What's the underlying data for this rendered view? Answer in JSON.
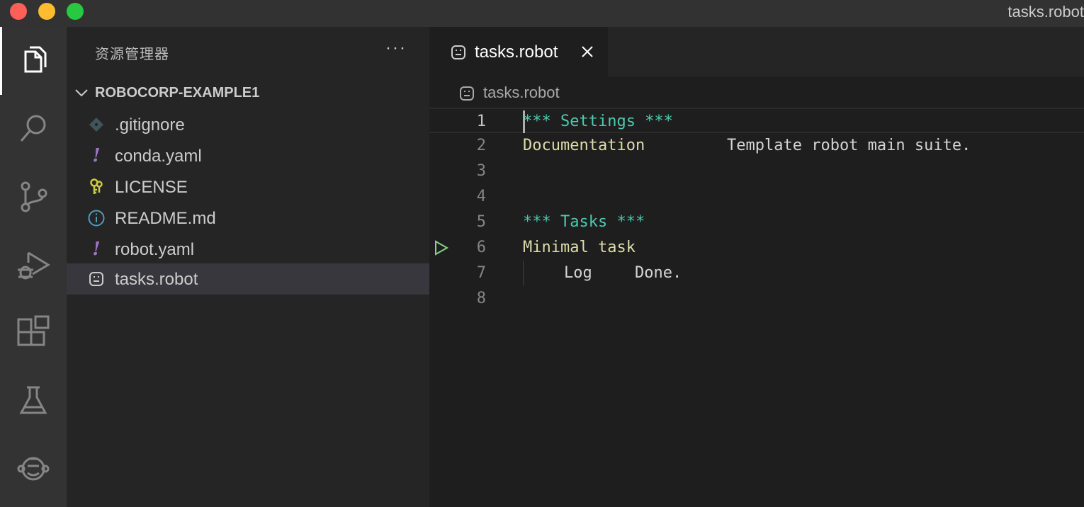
{
  "window": {
    "title": "tasks.robot"
  },
  "activity_bar": {
    "items": [
      {
        "icon": "files-icon",
        "active": true
      },
      {
        "icon": "search-icon",
        "active": false
      },
      {
        "icon": "source-control-icon",
        "active": false
      },
      {
        "icon": "run-debug-icon",
        "active": false
      },
      {
        "icon": "extensions-icon",
        "active": false
      },
      {
        "icon": "testing-icon",
        "active": false
      },
      {
        "icon": "robocorp-icon",
        "active": false
      }
    ]
  },
  "sidebar": {
    "title": "资源管理器",
    "more_label": "···",
    "folder": {
      "name": "ROBOCORP-EXAMPLE1",
      "expanded": true
    },
    "files": [
      {
        "name": ".gitignore",
        "icon": "git-icon"
      },
      {
        "name": "conda.yaml",
        "icon": "yaml-icon"
      },
      {
        "name": "LICENSE",
        "icon": "license-icon"
      },
      {
        "name": "README.md",
        "icon": "info-icon"
      },
      {
        "name": "robot.yaml",
        "icon": "yaml-icon"
      },
      {
        "name": "tasks.robot",
        "icon": "robot-icon",
        "selected": true
      }
    ]
  },
  "editor": {
    "tab": {
      "label": "tasks.robot",
      "active": true
    },
    "breadcrumb": "tasks.robot",
    "lines": [
      {
        "n": "1",
        "text": "*** Settings ***"
      },
      {
        "n": "2",
        "key": "Documentation",
        "value": "Template robot main suite."
      },
      {
        "n": "3",
        "text": ""
      },
      {
        "n": "4",
        "text": ""
      },
      {
        "n": "5",
        "text": "*** Tasks ***"
      },
      {
        "n": "6",
        "text": "Minimal task"
      },
      {
        "n": "7",
        "keyword": "Log",
        "arg": "Done."
      },
      {
        "n": "8",
        "text": ""
      }
    ]
  },
  "colors": {
    "section_header": "#4ec9b0",
    "keyword": "#dcdcaa",
    "yaml_icon": "#a074c4",
    "run_icon": "#89d185"
  }
}
